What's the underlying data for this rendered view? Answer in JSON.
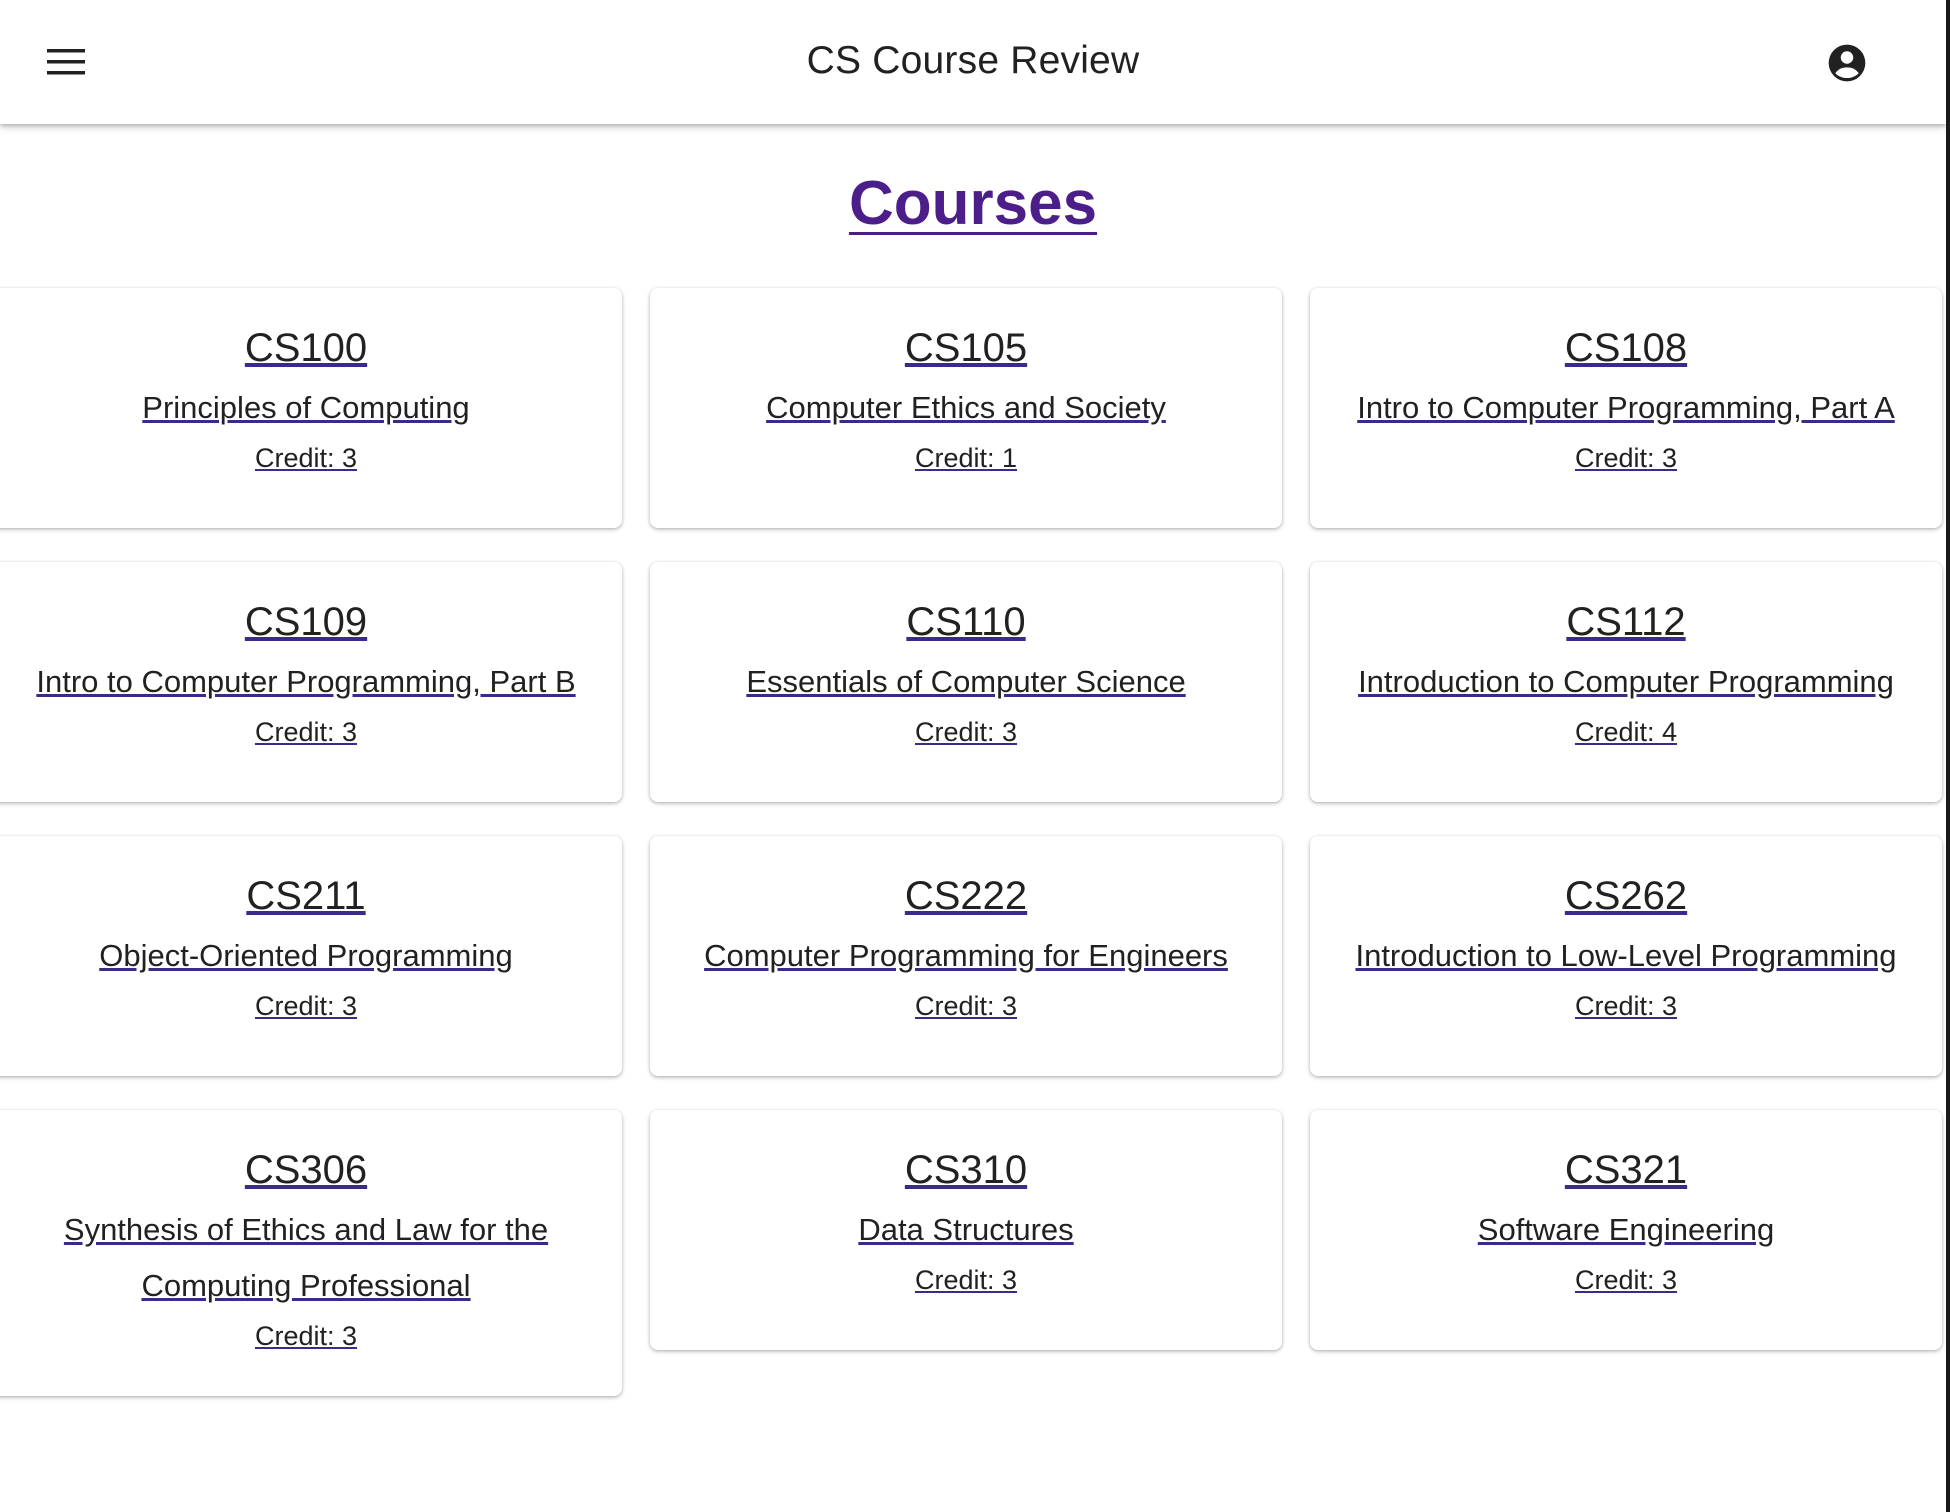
{
  "appbar": {
    "title": "CS Course Review",
    "menu_icon": "menu-icon",
    "account_icon": "account-circle-icon"
  },
  "page": {
    "heading": "Courses",
    "heading_color": "#4b1e8a"
  },
  "courses": [
    {
      "code": "CS100",
      "name": "Principles of Computing",
      "credit": "Credit: 3"
    },
    {
      "code": "CS105",
      "name": "Computer Ethics and Society",
      "credit": "Credit: 1"
    },
    {
      "code": "CS108",
      "name": "Intro to Computer Programming, Part A",
      "credit": "Credit: 3"
    },
    {
      "code": "CS109",
      "name": "Intro to Computer Programming, Part B",
      "credit": "Credit: 3"
    },
    {
      "code": "CS110",
      "name": "Essentials of Computer Science",
      "credit": "Credit: 3"
    },
    {
      "code": "CS112",
      "name": "Introduction to Computer Programming",
      "credit": "Credit: 4"
    },
    {
      "code": "CS211",
      "name": "Object-Oriented Programming",
      "credit": "Credit: 3"
    },
    {
      "code": "CS222",
      "name": "Computer Programming for Engineers",
      "credit": "Credit: 3"
    },
    {
      "code": "CS262",
      "name": "Introduction to Low-Level Programming",
      "credit": "Credit: 3"
    },
    {
      "code": "CS306",
      "name": "Synthesis of Ethics and Law for the Computing Professional",
      "credit": "Credit: 3"
    },
    {
      "code": "CS310",
      "name": "Data Structures",
      "credit": "Credit: 3"
    },
    {
      "code": "CS321",
      "name": "Software Engineering",
      "credit": "Credit: 3"
    }
  ]
}
